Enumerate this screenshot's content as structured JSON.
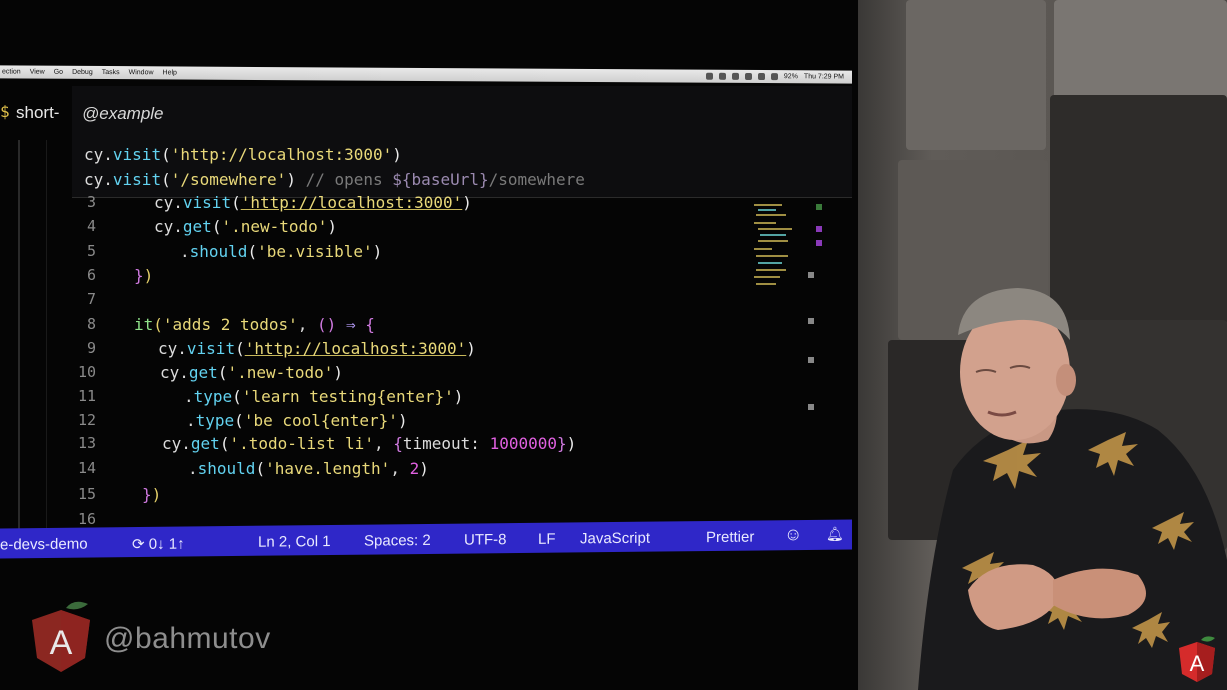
{
  "menubar": {
    "items": [
      "ection",
      "View",
      "Go",
      "Debug",
      "Tasks",
      "Window",
      "Help"
    ],
    "clock": "Thu 7:29 PM",
    "battery": "92%"
  },
  "tab": {
    "label": "short-"
  },
  "tooltip": {
    "tag": "@example",
    "example1": {
      "obj": "cy",
      "method": "visit",
      "arg": "'http://localhost:3000'"
    },
    "example2": {
      "obj": "cy",
      "method": "visit",
      "arg": "'/somewhere'",
      "comment": "// opens ",
      "var": "${baseUrl}",
      "comment_tail": "/somewhere"
    }
  },
  "code": {
    "lines": [
      {
        "n": "3",
        "text": "cy.visit('http://localhost:3000')"
      },
      {
        "n": "4",
        "text": "cy.get('.new-todo')"
      },
      {
        "n": "5",
        "text": ".should('be.visible')"
      },
      {
        "n": "6",
        "text": "})"
      },
      {
        "n": "7",
        "text": ""
      },
      {
        "n": "8",
        "text": "it('adds 2 todos', () => {"
      },
      {
        "n": "9",
        "text": "cy.visit('http://localhost:3000')"
      },
      {
        "n": "10",
        "text": "cy.get('.new-todo')"
      },
      {
        "n": "11",
        "text": ".type('learn testing{enter}')"
      },
      {
        "n": "12",
        "text": ".type('be cool{enter}')"
      },
      {
        "n": "13",
        "text": "cy.get('.todo-list li', {timeout: 1000000})"
      },
      {
        "n": "14",
        "text": ".should('have.length', 2)"
      },
      {
        "n": "15",
        "text": "})"
      },
      {
        "n": "16",
        "text": ""
      }
    ]
  },
  "statusbar": {
    "project": "e-devs-demo",
    "sync": "0↓ 1↑",
    "position": "Ln 2, Col 1",
    "spaces": "Spaces: 2",
    "encoding": "UTF-8",
    "eol": "LF",
    "language": "JavaScript",
    "formatter": "Prettier"
  },
  "watermark": {
    "handle": "@bahmutov"
  },
  "colors": {
    "status_bar": "#2f27c8",
    "angular_red": "#d52b2b"
  }
}
